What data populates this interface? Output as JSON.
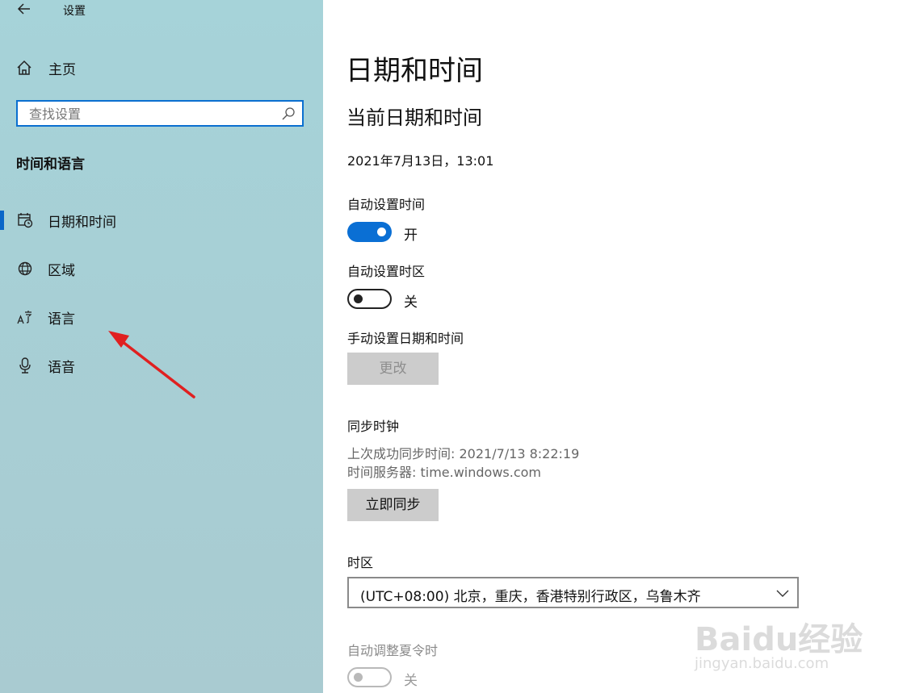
{
  "window": {
    "title": "设置"
  },
  "sidebar": {
    "home_label": "主页",
    "search_placeholder": "查找设置",
    "section_title": "时间和语言",
    "items": [
      {
        "label": "日期和时间",
        "icon": "calendar-clock-icon",
        "selected": true
      },
      {
        "label": "区域",
        "icon": "globe-icon",
        "selected": false
      },
      {
        "label": "语言",
        "icon": "language-icon",
        "selected": false
      },
      {
        "label": "语音",
        "icon": "microphone-icon",
        "selected": false
      }
    ]
  },
  "main": {
    "title": "日期和时间",
    "subtitle": "当前日期和时间",
    "current_datetime": "2021年7月13日，13:01",
    "auto_time": {
      "label": "自动设置时间",
      "state": "开",
      "on": true
    },
    "auto_timezone": {
      "label": "自动设置时区",
      "state": "关",
      "on": false
    },
    "manual": {
      "label": "手动设置日期和时间",
      "button": "更改"
    },
    "sync": {
      "label": "同步时钟",
      "last_sync": "上次成功同步时间: 2021/7/13 8:22:19",
      "server": "时间服务器: time.windows.com",
      "button": "立即同步"
    },
    "timezone": {
      "label": "时区",
      "value": "(UTC+08:00) 北京，重庆，香港特别行政区，乌鲁木齐"
    },
    "dst": {
      "label": "自动调整夏令时",
      "state": "关",
      "on": false,
      "disabled": true
    }
  },
  "watermark": {
    "brand": "Baidu经验",
    "url": "jingyan.baidu.com"
  },
  "colors": {
    "accent": "#0a6fd4",
    "sidebar_bg": "#a7cfd5",
    "annotation_arrow": "#e02020"
  }
}
